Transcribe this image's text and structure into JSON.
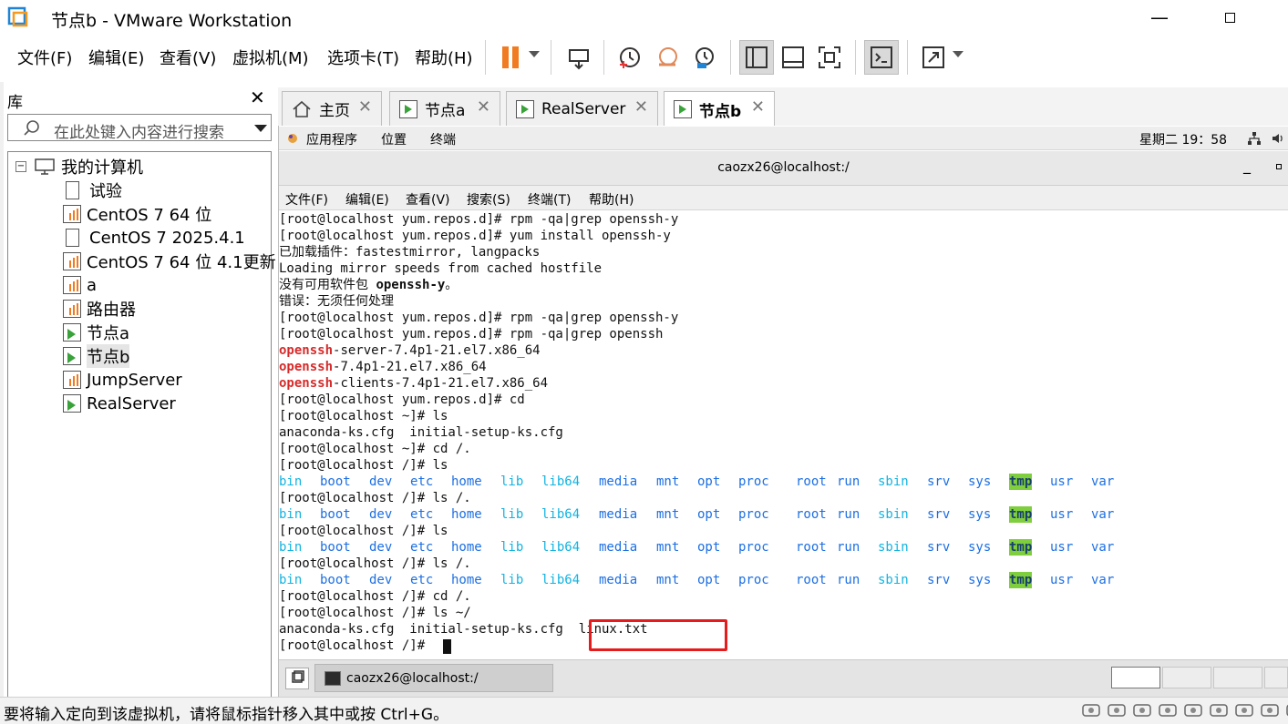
{
  "window": {
    "title": "节点b - VMware Workstation",
    "minimize": "—"
  },
  "menu": [
    "文件(F)",
    "编辑(E)",
    "查看(V)",
    "虚拟机(M)",
    "选项卡(T)",
    "帮助(H)"
  ],
  "library": {
    "header": "库",
    "close": "✕",
    "search_placeholder": "在此处键入内容进行搜索",
    "tree": [
      {
        "label": "我的计算机",
        "type": "root"
      },
      {
        "label": "试验",
        "type": "doc"
      },
      {
        "label": "CentOS 7 64 位",
        "type": "vm"
      },
      {
        "label": "CentOS 7 2025.4.1",
        "type": "doc"
      },
      {
        "label": "CentOS 7 64 位 4.1更新",
        "type": "vm"
      },
      {
        "label": "a",
        "type": "vm"
      },
      {
        "label": "路由器",
        "type": "vm"
      },
      {
        "label": "节点a",
        "type": "vm-run"
      },
      {
        "label": "节点b",
        "type": "vm-run",
        "selected": true
      },
      {
        "label": "JumpServer",
        "type": "vm"
      },
      {
        "label": "RealServer",
        "type": "vm-run"
      }
    ]
  },
  "tabs": [
    {
      "label": "主页",
      "icon": "home-icon"
    },
    {
      "label": "节点a",
      "icon": "vm-run-icon"
    },
    {
      "label": "RealServer",
      "icon": "vm-run-icon"
    },
    {
      "label": "节点b",
      "icon": "vm-run-icon",
      "active": true
    }
  ],
  "gnome": {
    "apps": "应用程序",
    "places": "位置",
    "terminal": "终端",
    "clock": "星期二 19：58"
  },
  "terminal": {
    "title": "caozx26@localhost:/",
    "menu": [
      "文件(F)",
      "编辑(E)",
      "查看(V)",
      "搜索(S)",
      "终端(T)",
      "帮助(H)"
    ],
    "lines": [
      "[root@localhost yum.repos.d]# rpm -qa|grep openssh-y",
      "[root@localhost yum.repos.d]# yum install openssh-y",
      "已加载插件：fastestmirror, langpacks",
      "Loading mirror speeds from cached hostfile",
      "没有可用软件包 openssh-y。",
      "错误：无须任何处理",
      "[root@localhost yum.repos.d]# rpm -qa|grep openssh-y",
      "[root@localhost yum.repos.d]# rpm -qa|grep openssh",
      "-server-7.4p1-21.el7.x86_64",
      "-7.4p1-21.el7.x86_64",
      "-clients-7.4p1-21.el7.x86_64",
      "[root@localhost yum.repos.d]# cd",
      "[root@localhost ~]# ls",
      "anaconda-ks.cfg  initial-setup-ks.cfg",
      "[root@localhost ~]# cd /.",
      "[root@localhost /]# ls",
      "",
      "[root@localhost /]# ls /.",
      "",
      "[root@localhost /]# ls",
      "",
      "[root@localhost /]# ls /.",
      "",
      "[root@localhost /]# cd /.",
      "[root@localhost /]# ls ~/",
      "anaconda-ks.cfg  initial-setup-ks.cfg  linux.txt",
      "[root@localhost /]# "
    ],
    "openssh_word": "openssh",
    "pkg_not_found": "openssh-y",
    "dirs": [
      "bin",
      "boot",
      "dev",
      "etc",
      "home",
      "lib",
      "lib64",
      "media",
      "mnt",
      "opt",
      "proc",
      "root",
      "run",
      "sbin",
      "srv",
      "sys",
      "tmp",
      "usr",
      "var"
    ]
  },
  "taskbar": {
    "item": "caozx26@localhost:/"
  },
  "status": {
    "text": "要将输入定向到该虚拟机，请将鼠标指针移入其中或按 Ctrl+G。"
  },
  "colors": {
    "accent_orange": "#f07b21",
    "highlight_red": "#e61c1c",
    "tmp_bg": "#7fce3e",
    "dir_blue": "#1c6fe3",
    "link_cyan": "#12b3e0"
  }
}
